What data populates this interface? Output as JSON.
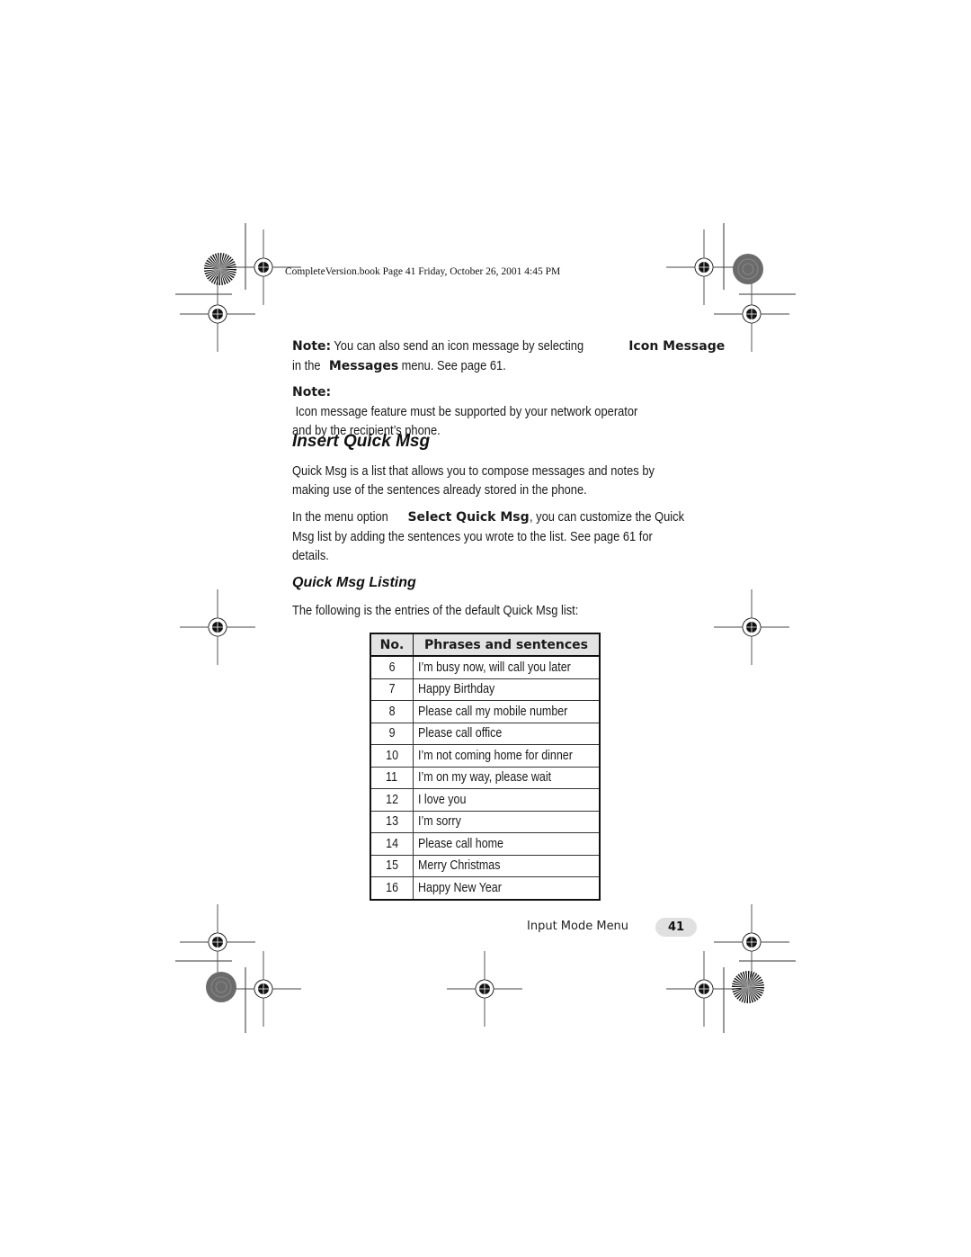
{
  "print_header": {
    "text": "CompleteVersion.book  Page 41  Friday, October 26, 2001  4:45 PM"
  },
  "notes": [
    {
      "label": "Note:",
      "text_before": " You can also send an icon message by selecting ",
      "bold1": "Icon Message",
      "line2_before": "in the ",
      "bold2": "Messages",
      "line2_after": " menu. See page 61."
    },
    {
      "label": "Note:",
      "line1": " Icon message feature must be supported by your network operator",
      "line2": "and by the recipient’s phone."
    }
  ],
  "section": {
    "title": "Insert Quick Msg",
    "para1_line1": "Quick Msg is a list that allows you to compose messages and notes by",
    "para1_line2": "making use of the sentences already stored in the phone.",
    "para2_before": "In the menu option ",
    "para2_bold": "Select Quick Msg",
    "para2_after": ", you can customize the Quick",
    "para2_line2": "Msg list by adding the sentences you wrote to the list. See page 61 for",
    "para2_line3": "details."
  },
  "subsection": {
    "title": "Quick Msg Listing",
    "intro": "The following is the entries of the default Quick Msg list:"
  },
  "table": {
    "headers": [
      "No.",
      "Phrases and sentences"
    ],
    "rows": [
      {
        "no": "6",
        "text": "I’m busy now, will call you later"
      },
      {
        "no": "7",
        "text": "Happy Birthday"
      },
      {
        "no": "8",
        "text": "Please call my mobile number"
      },
      {
        "no": "9",
        "text": "Please call office"
      },
      {
        "no": "10",
        "text": "I’m not coming home for dinner"
      },
      {
        "no": "11",
        "text": "I’m on my way, please wait"
      },
      {
        "no": "12",
        "text": "I love you"
      },
      {
        "no": "13",
        "text": "I’m sorry"
      },
      {
        "no": "14",
        "text": "Please call home"
      },
      {
        "no": "15",
        "text": "Merry Christmas"
      },
      {
        "no": "16",
        "text": "Happy New Year"
      }
    ]
  },
  "footer": {
    "section_label": "Input Mode Menu",
    "page_number": "41"
  },
  "colors": {
    "header_fill": "#e3e3e3",
    "pill_fill": "#e0e0e0",
    "text": "#1a1a1a"
  }
}
